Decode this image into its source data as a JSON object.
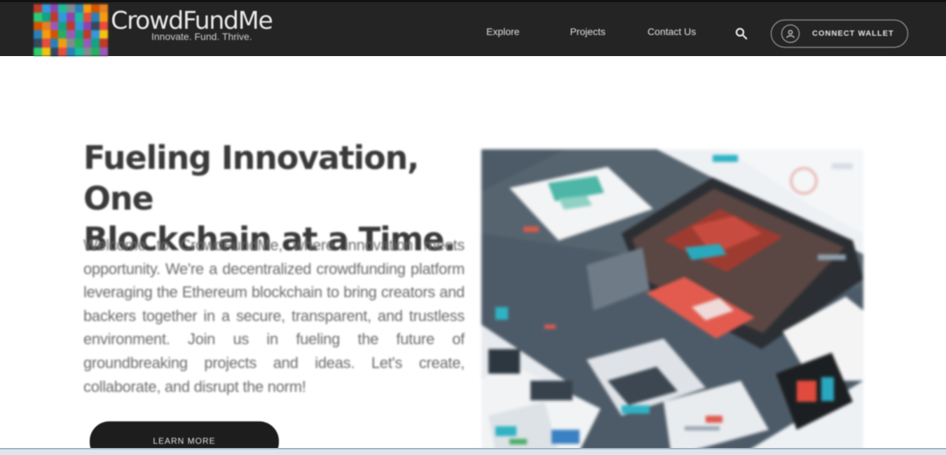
{
  "brand": {
    "name": "CrowdFundMe",
    "tagline": "Innovate. Fund. Thrive.",
    "logo_colors": [
      "#c0392b",
      "#e67e22",
      "#27ae60",
      "#2980b9",
      "#8e44ad",
      "#f1c40f",
      "#16a085",
      "#d35400",
      "#7f8c8d",
      "#e74c3c",
      "#3498db",
      "#2ecc71",
      "#9b59b6",
      "#f39c12",
      "#1abc9c",
      "#34495e"
    ]
  },
  "nav": {
    "links": [
      "Explore",
      "Projects",
      "Contact Us"
    ],
    "search_icon": "search-icon",
    "wallet_icon": "user-icon",
    "wallet_label": "CONNECT WALLET"
  },
  "hero": {
    "title_line1": "Fueling Innovation, One",
    "title_line2": "Blockchain at a Time.",
    "paragraph": "Welcome to CrowdFundMe, where innovation meets opportunity. We're a decentralized crowdfunding platform leveraging the Ethereum blockchain to bring creators and backers together in a secure, transparent, and trustless environment. Join us in fueling the future of groundbreaking projects and ideas. Let's create, collaborate, and disrupt the norm!",
    "button_label": "LEARN MORE",
    "image_subject": "ui-mockup-collage"
  },
  "colors": {
    "nav_bg": "#242424",
    "button_bg": "#1d1d1d",
    "accent_red": "#e05a4e",
    "accent_teal": "#2fb3c4"
  }
}
